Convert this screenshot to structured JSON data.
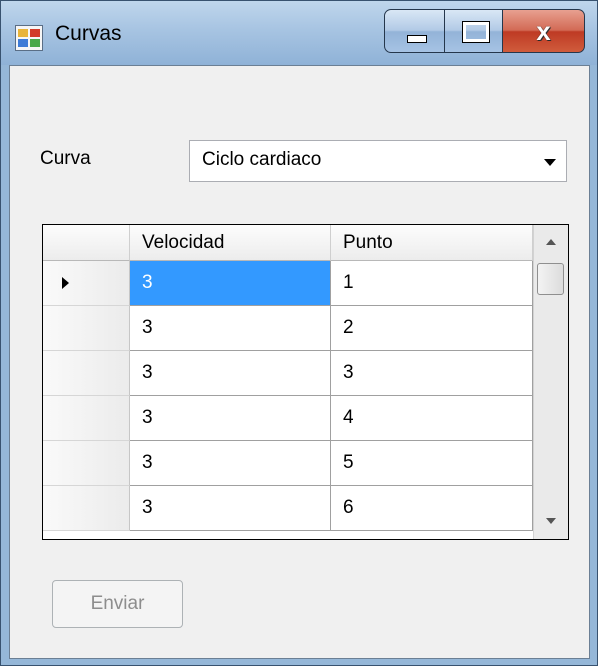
{
  "window": {
    "title": "Curvas",
    "controls": {
      "close": "x"
    }
  },
  "form": {
    "curva_label": "Curva",
    "curva_selected": "Ciclo cardiaco"
  },
  "grid": {
    "columns": [
      "Velocidad",
      "Punto"
    ],
    "rows": [
      [
        "3",
        "1"
      ],
      [
        "3",
        "2"
      ],
      [
        "3",
        "3"
      ],
      [
        "3",
        "4"
      ],
      [
        "3",
        "5"
      ],
      [
        "3",
        "6"
      ]
    ],
    "selected_row": 0,
    "selected_col": 0
  },
  "send_button_label": "Enviar",
  "colors": {
    "selection": "#3399ff",
    "title_bar": "#a7c4e2",
    "close_button": "#c84a33"
  }
}
